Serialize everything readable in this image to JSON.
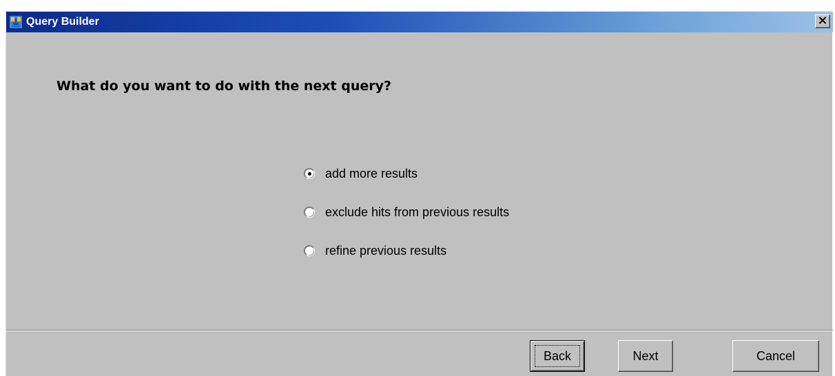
{
  "window": {
    "title": "Query Builder",
    "icon": "query-builder-app-icon",
    "close_icon": "close-icon"
  },
  "question": "What do you want to do with the next query?",
  "options": [
    {
      "label": "add more results",
      "selected": true
    },
    {
      "label": "exclude hits from previous results",
      "selected": false
    },
    {
      "label": "refine previous results",
      "selected": false
    }
  ],
  "buttons": {
    "back": "Back",
    "next": "Next",
    "cancel": "Cancel"
  },
  "colors": {
    "dialog_bg": "#c0c0c0",
    "titlebar_start": "#0b2a8c",
    "titlebar_end": "#9cc1e8",
    "title_text": "#ffffff"
  }
}
